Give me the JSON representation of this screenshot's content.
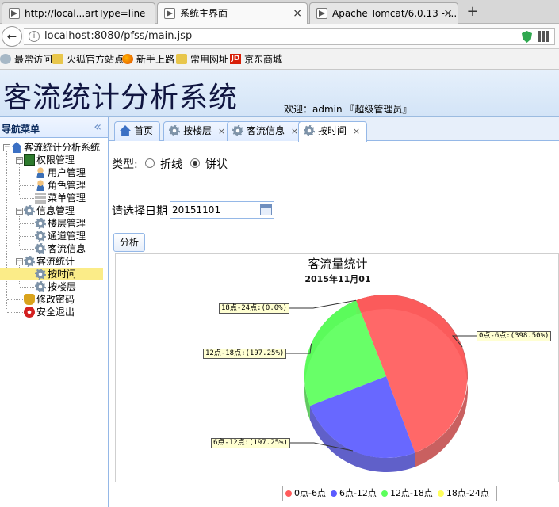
{
  "browser": {
    "tabs": [
      {
        "label": "http://local...artType=line",
        "active": false
      },
      {
        "label": "系统主界面",
        "active": true
      },
      {
        "label": "Apache Tomcat/6.0.13 - ...",
        "active": false
      }
    ],
    "new_tab": "+",
    "url": "localhost:8080/pfss/main.jsp",
    "bookmarks": [
      "最常访问",
      "火狐官方站点",
      "新手上路",
      "常用网址",
      "京东商城"
    ]
  },
  "header": {
    "title": "客流统计分析系统",
    "welcome": "欢迎：admin 『超级管理员』"
  },
  "sidebar": {
    "title": "导航菜单",
    "collapse_icon": "«",
    "root": "客流统计分析系统",
    "groups": {
      "perm": "权限管理",
      "perm_items": [
        "用户管理",
        "角色管理",
        "菜单管理"
      ],
      "info": "信息管理",
      "info_items": [
        "楼层管理",
        "通道管理",
        "客流信息"
      ],
      "stat": "客流统计",
      "stat_items": [
        "按时间",
        "按楼层"
      ],
      "pwd": "修改密码",
      "exit": "安全退出"
    },
    "selected": "按时间"
  },
  "content_tabs": [
    {
      "label": "首页",
      "closable": false
    },
    {
      "label": "按楼层",
      "closable": true
    },
    {
      "label": "客流信息",
      "closable": true
    },
    {
      "label": "按时间",
      "closable": true,
      "active": true
    }
  ],
  "close_glyph": "×",
  "form": {
    "type_label": "类型:",
    "options": [
      "折线",
      "饼状"
    ],
    "selected_option": "饼状",
    "date_label": "请选择日期",
    "date_value": "20151101",
    "analyze_button": "分析"
  },
  "chart_data": {
    "type": "pie",
    "title": "客流量统计",
    "subtitle": "2015年11月01",
    "categories": [
      "0点-6点",
      "6点-12点",
      "12点-18点",
      "18点-24点"
    ],
    "values": [
      398.5,
      197.25,
      197.25,
      0.0
    ],
    "labels": [
      "0点-6点:(398.50%)",
      "6点-12点:(197.25%)",
      "12点-18点:(197.25%)",
      "18点-24点:(0.0%)"
    ],
    "colors": [
      "#ff5b5b",
      "#5b5bff",
      "#5bff5b",
      "#ffff5b"
    ],
    "legend_position": "bottom-right"
  }
}
